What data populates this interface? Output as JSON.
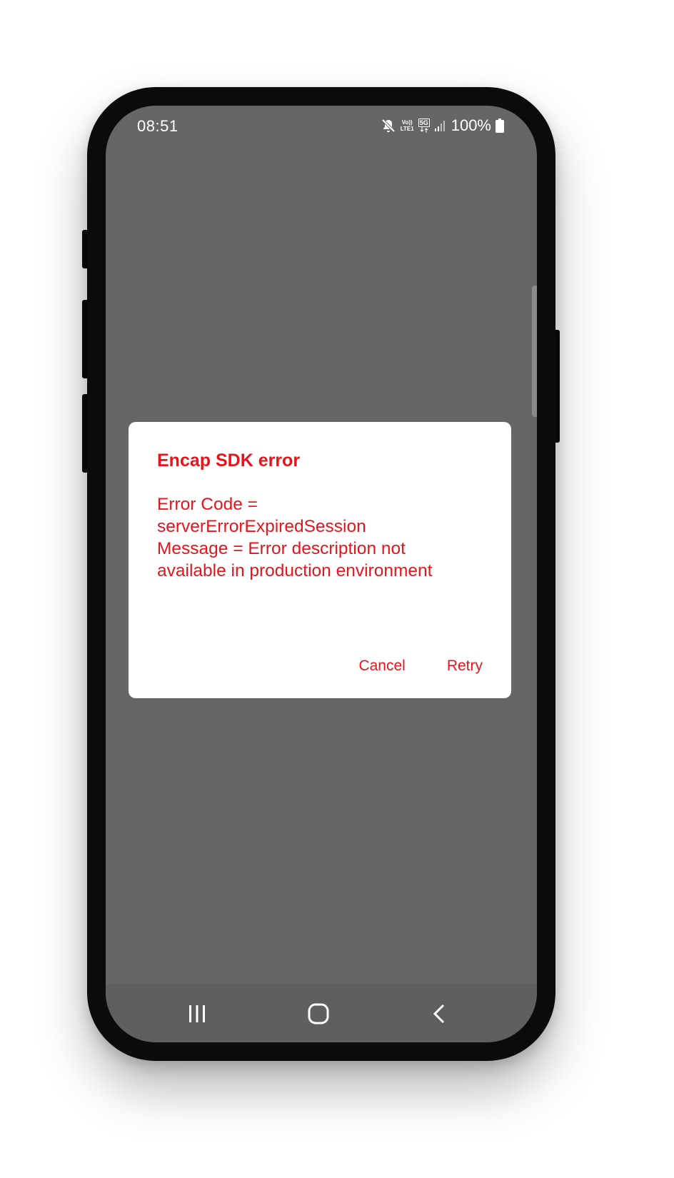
{
  "status_bar": {
    "time": "08:51",
    "network_top": "Vo))",
    "network_bottom": "LTE1",
    "network_5g": "5G",
    "battery": "100%",
    "icons": [
      "mute-icon",
      "signal-icon",
      "battery-icon"
    ]
  },
  "dialog": {
    "title": "Encap SDK error",
    "lines": [
      "Error Code =",
      "serverErrorExpiredSession",
      "Message = Error description not",
      "available in production environment"
    ],
    "cancel_label": "Cancel",
    "retry_label": "Retry"
  },
  "nav_bar": {
    "icons": [
      "recent-apps-icon",
      "home-icon",
      "back-icon"
    ]
  },
  "colors": {
    "accent": "#e8141b",
    "scrim": "#666666",
    "dialog_bg": "#ffffff"
  }
}
